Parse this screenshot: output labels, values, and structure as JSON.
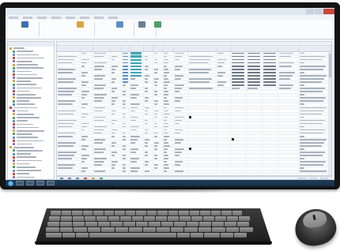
{
  "window": {
    "title": "",
    "menus": [
      "",
      "",
      "",
      "",
      "",
      "",
      "",
      ""
    ]
  },
  "ribbon": {
    "groups": [
      {
        "label": "",
        "icon": "binoculars-icon",
        "color": "#3f6fb0"
      },
      {
        "label": "",
        "icon": "calendar-icon",
        "color": "#d9a441"
      },
      {
        "label": "",
        "icon": "table-icon",
        "color": "#5b8fc9"
      },
      {
        "label": "",
        "icon": "print-icon",
        "color": "#6c7f93"
      },
      {
        "label": "",
        "icon": "chart-icon",
        "color": "#4aa167"
      }
    ]
  },
  "tree": {
    "header": "",
    "item_count": 41,
    "icon_colors": [
      "#d9a441",
      "#4aa167",
      "#5b8fc9",
      "#c9473b",
      "#8a6fb8"
    ]
  },
  "grid": {
    "columns": [
      "",
      "",
      "",
      "",
      "",
      "",
      "",
      "",
      "",
      "",
      "",
      "",
      "",
      "",
      "",
      "",
      ""
    ],
    "row_count": 38
  },
  "status": {
    "legend_colors": [
      "#4aa167",
      "#d9a441",
      "#c9473b",
      "#5b8fc9",
      "#8a6fb8",
      "#6c7f93"
    ]
  },
  "taskbar": {
    "clock": ""
  },
  "colors": {
    "bezel": "#141414",
    "window_bg": "#f3f5f8",
    "taskbar": "#1f3d5a",
    "accent": "#5b8fc9"
  }
}
